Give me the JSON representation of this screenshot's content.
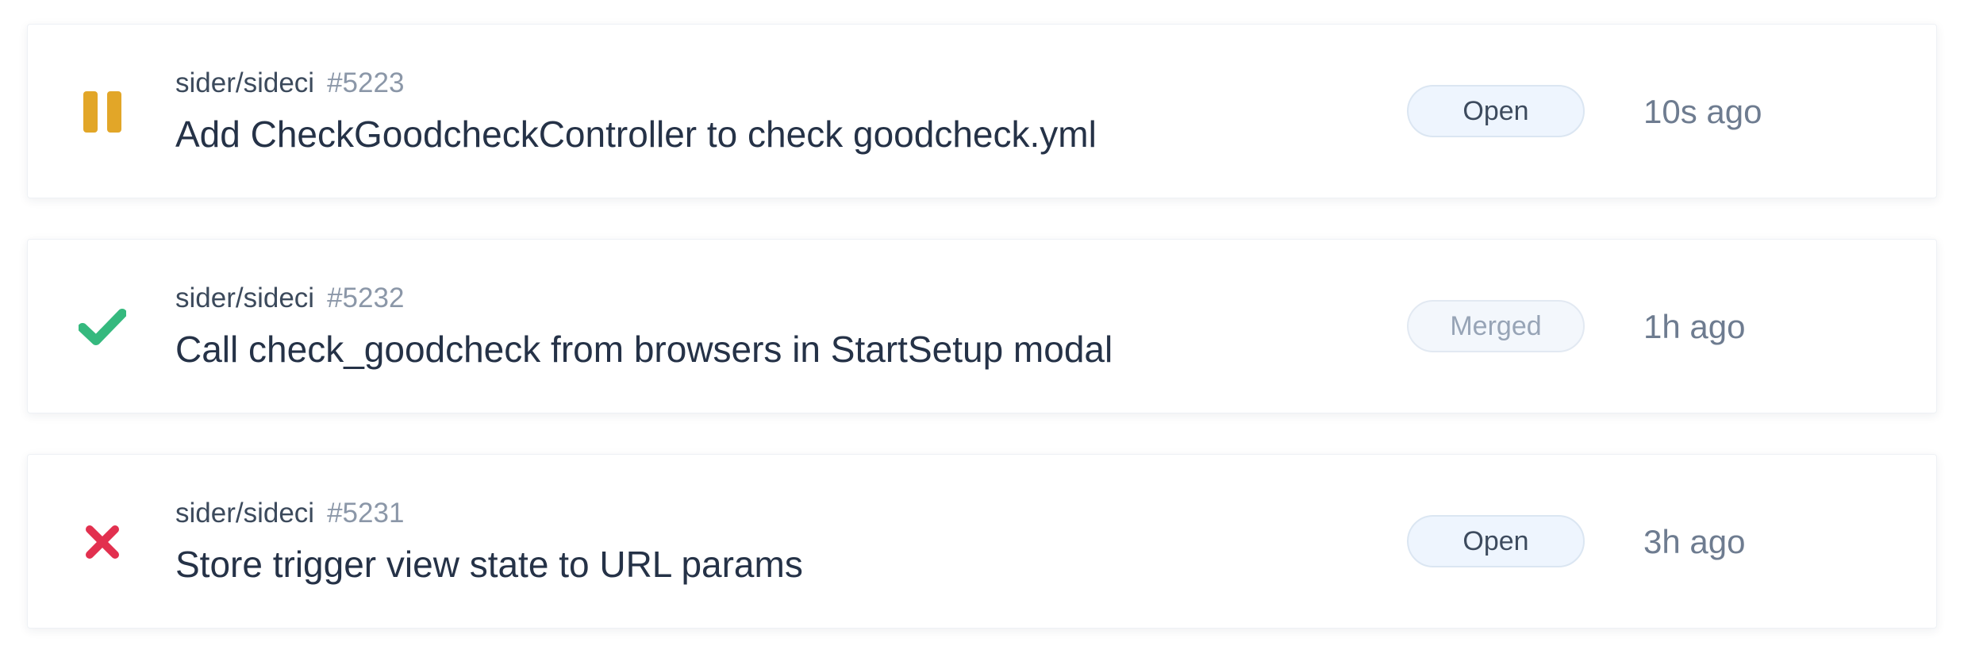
{
  "pull_requests": [
    {
      "status": "paused",
      "status_icon": "pause-icon",
      "status_color": "#e2a628",
      "repo": "sider/sideci",
      "number": "#5223",
      "title": "Add CheckGoodcheckController to check goodcheck.yml",
      "state": "Open",
      "time": "10s ago"
    },
    {
      "status": "success",
      "status_icon": "check-icon",
      "status_color": "#35b97e",
      "repo": "sider/sideci",
      "number": "#5232",
      "title": "Call check_goodcheck from browsers in StartSetup modal",
      "state": "Merged",
      "time": "1h ago"
    },
    {
      "status": "failure",
      "status_icon": "cross-icon",
      "status_color": "#e2304f",
      "repo": "sider/sideci",
      "number": "#5231",
      "title": "Store trigger view state to URL params",
      "state": "Open",
      "time": "3h ago"
    }
  ]
}
